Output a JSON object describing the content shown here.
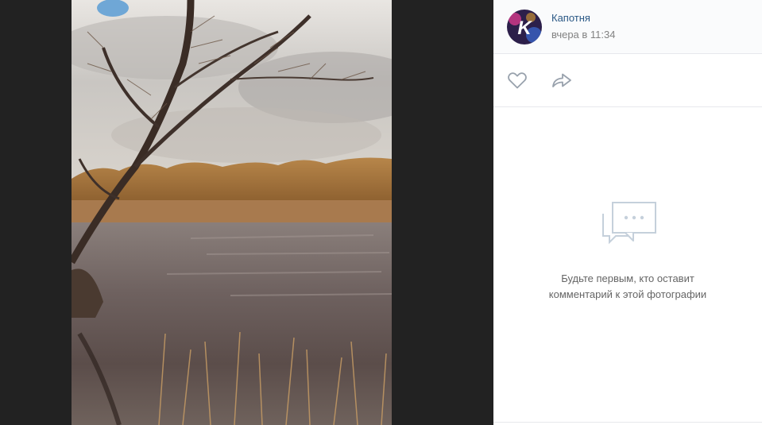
{
  "photo": {
    "description_icon": "photo-landscape-lake-tree"
  },
  "post": {
    "author_name": "Капотня",
    "time": "вчера в 11:34",
    "avatar_letter": "K"
  },
  "actions": {
    "like_icon": "heart-icon",
    "share_icon": "share-arrow-icon"
  },
  "comments": {
    "empty_line1": "Будьте первым, кто оставит",
    "empty_line2": "комментарий к этой фотографии",
    "empty_icon": "chat-bubbles-icon"
  },
  "colors": {
    "link": "#2a5885",
    "muted": "#828282",
    "icon": "#99a2ad",
    "viewer_bg": "#222222"
  }
}
